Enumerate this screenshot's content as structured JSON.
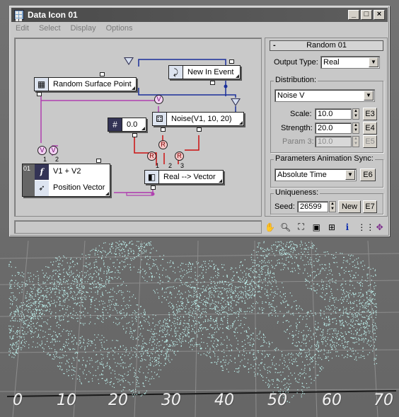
{
  "window": {
    "title": "Data Icon 01",
    "minimize": "_",
    "maximize": "□",
    "close": "×"
  },
  "menu": [
    "Edit",
    "Select",
    "Display",
    "Options"
  ],
  "nodes": {
    "random_surface_point": "Random Surface Point",
    "new_in_event": "New In Event",
    "noise": "Noise(V1, 10, 20)",
    "constant": "0.0",
    "v1_plus_v2": "V1 + V2",
    "position_vector": "Position Vector",
    "real_to_vector": "Real --> Vector",
    "row_index": "01",
    "v_symbol": "V",
    "r_symbol": "R",
    "port_1": "1",
    "port_2": "2",
    "port_3": "3",
    "hash_glyph": "#",
    "func_glyph": "f"
  },
  "panel": {
    "rollout_title": "Random 01",
    "rollout_toggle": "-",
    "output_type_label": "Output Type:",
    "output_type_value": "Real",
    "distribution_group": "Distribution:",
    "distribution_value": "Noise V",
    "scale_label": "Scale:",
    "scale_value": "10.0",
    "scale_btn": "E3",
    "strength_label": "Strength:",
    "strength_value": "20.0",
    "strength_btn": "E4",
    "param3_label": "Param 3:",
    "param3_value": "10.0",
    "param3_btn": "E5",
    "anim_sync_group": "Parameters Animation Sync:",
    "anim_sync_value": "Absolute Time",
    "anim_sync_btn": "E6",
    "uniqueness_group": "Uniqueness:",
    "seed_label": "Seed:",
    "seed_value": "26599",
    "new_btn": "New",
    "seed_btn": "E7"
  },
  "toolbar_icons": [
    "pan-hand-icon",
    "zoom-icon",
    "zoom-extents-icon",
    "region-zoom-icon",
    "fit-icon",
    "info-icon",
    "grid-icon",
    "arrows-icon"
  ],
  "viewport": {
    "axis_labels": [
      "0",
      "10",
      "20",
      "30",
      "40",
      "50",
      "60",
      "70"
    ]
  },
  "colors": {
    "particles": "#bff4f0",
    "purple_wire": "#b040b0",
    "red_wire": "#cc1111",
    "blue_wire": "#1a2f9a"
  }
}
